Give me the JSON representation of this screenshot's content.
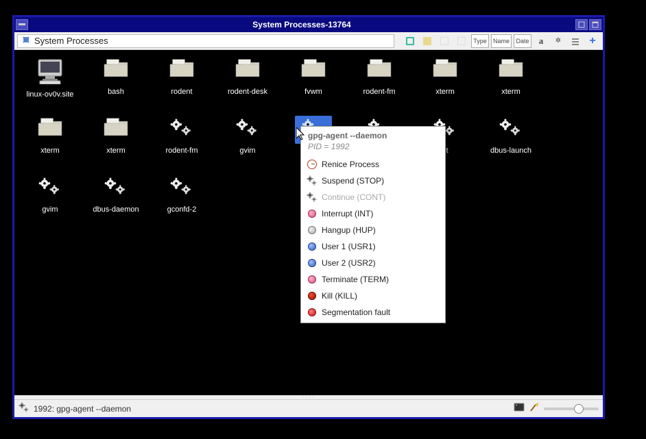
{
  "window": {
    "title": "System Processes-13764"
  },
  "toolbar": {
    "location": "System Processes",
    "sort_buttons": {
      "type": "Type",
      "name": "Name",
      "date": "Date"
    }
  },
  "processes": [
    {
      "label": "linux-ov0v.site",
      "icon": "monitor"
    },
    {
      "label": "bash",
      "icon": "folder"
    },
    {
      "label": "rodent",
      "icon": "folder"
    },
    {
      "label": "rodent-desk",
      "icon": "folder"
    },
    {
      "label": "fvwm",
      "icon": "folder"
    },
    {
      "label": "rodent-fm",
      "icon": "folder"
    },
    {
      "label": "xterm",
      "icon": "folder"
    },
    {
      "label": "xterm",
      "icon": "folder"
    },
    {
      "label": "",
      "icon": "empty"
    },
    {
      "label": "xterm",
      "icon": "folder"
    },
    {
      "label": "xterm",
      "icon": "folder"
    },
    {
      "label": "rodent-fm",
      "icon": "gears"
    },
    {
      "label": "gvim",
      "icon": "gears"
    },
    {
      "label": "gpg-agent",
      "icon": "gears-blue",
      "truncated": "gpg-",
      "selected": true
    },
    {
      "label": "",
      "icon": "gears",
      "hidden_label": true
    },
    {
      "label": "",
      "icon": "gears",
      "partial": "nt"
    },
    {
      "label": "dbus-launch",
      "icon": "gears"
    },
    {
      "label": "",
      "icon": "empty"
    },
    {
      "label": "gvim",
      "icon": "gears"
    },
    {
      "label": "dbus-daemon",
      "icon": "gears"
    },
    {
      "label": "gconfd-2",
      "icon": "gears"
    }
  ],
  "context_menu": {
    "header_cmd": "gpg-agent --daemon",
    "header_pid": "PID = 1992",
    "items": [
      {
        "label": "Renice Process",
        "icon": "clock",
        "enabled": true
      },
      {
        "label": "Suspend (STOP)",
        "icon": "gears",
        "enabled": true
      },
      {
        "label": "Continue (CONT)",
        "icon": "gears",
        "enabled": false
      },
      {
        "label": "Interrupt (INT)",
        "icon": "pink",
        "enabled": true
      },
      {
        "label": "Hangup (HUP)",
        "icon": "grey",
        "enabled": true
      },
      {
        "label": "User 1 (USR1)",
        "icon": "blue",
        "enabled": true
      },
      {
        "label": "User 2 (USR2)",
        "icon": "blue",
        "enabled": true
      },
      {
        "label": "Terminate (TERM)",
        "icon": "pink",
        "enabled": true
      },
      {
        "label": "Kill (KILL)",
        "icon": "darkred",
        "enabled": true
      },
      {
        "label": "Segmentation fault",
        "icon": "red",
        "enabled": true
      }
    ]
  },
  "status": {
    "text": "1992: gpg-agent --daemon"
  }
}
